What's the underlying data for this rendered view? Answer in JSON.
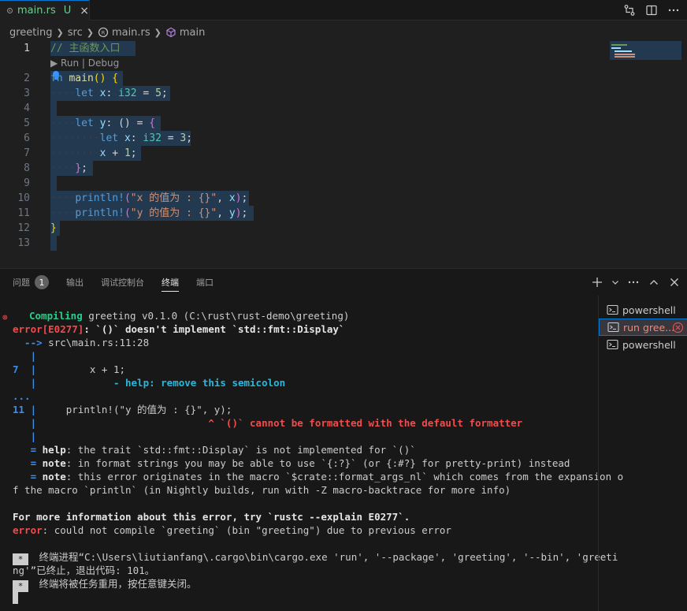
{
  "tabbar": {
    "file_name": "main.rs",
    "file_status": "U",
    "close": "×"
  },
  "breadcrumb": [
    "greeting",
    "src",
    "main.rs",
    "main"
  ],
  "editor": {
    "codelens": "▶ Run | Debug",
    "lines": [
      {
        "n": "1",
        "comment": "// 主函数入口"
      },
      {
        "n": "2"
      },
      {
        "n": "3"
      },
      {
        "n": "4"
      },
      {
        "n": "5"
      },
      {
        "n": "6"
      },
      {
        "n": "7"
      },
      {
        "n": "8"
      },
      {
        "n": "9"
      },
      {
        "n": "10"
      },
      {
        "n": "11"
      },
      {
        "n": "12"
      },
      {
        "n": "13"
      }
    ],
    "code": {
      "fn_kw": "fn",
      "main": "main",
      "let": "let",
      "x": "x",
      "y": "y",
      "i32": "i32",
      "five": "5",
      "three": "3",
      "one": "1",
      "println": "println!",
      "str_x": "\"x 的值为 : {}\"",
      "str_y": "\"y 的值为 : {}\""
    }
  },
  "panel": {
    "tabs": [
      {
        "label": "问题",
        "badge": "1"
      },
      {
        "label": "输出"
      },
      {
        "label": "调试控制台"
      },
      {
        "label": "终端"
      },
      {
        "label": "端口"
      }
    ],
    "terminal_list": [
      "powershell",
      "run gree...",
      "powershell"
    ]
  },
  "terminal": {
    "compiling_label": "Compiling",
    "compiling_rest": " greeting v0.1.0 (C:\\rust\\rust-demo\\greeting)",
    "error_code": "error[E0277]",
    "error_msg": ": `()` doesn't implement `std::fmt::Display`",
    "arrow": "  -->",
    "location": " src\\main.rs:11:28",
    "pipe": "   |",
    "ln7": "7",
    "ln7_pipe": "  |",
    "ln7_code": "         x + 1;",
    "help_line": "             - help: remove this semicolon",
    "dots": "...",
    "ln11": "11",
    "ln11_pipe": " |",
    "ln11_code": "     println!(\"y 的值为 : {}\", y);",
    "caret_line": "                             ^ `()` cannot be formatted with the default formatter",
    "eq": "   = ",
    "help_kw": "help",
    "help_text": ": the trait `std::fmt::Display` is not implemented for `()`",
    "note_kw": "note",
    "note1_text": ": in format strings you may be able to use `{:?}` (or {:#?} for pretty-print) instead",
    "note2_text": ": this error originates in the macro `$crate::format_args_nl` which comes from the expansion o",
    "note2_cont": "f the macro `println` (in Nightly builds, run with -Z macro-backtrace for more info)",
    "more_info": "For more information about this error, try `rustc --explain E0277`.",
    "error_kw": "error",
    "could_not": ": could not compile `greeting` (bin \"greeting\") due to previous error",
    "star": "*",
    "proc_end_1": " 终端进程“C:\\Users\\liutianfang\\.cargo\\bin\\cargo.exe 'run', '--package', 'greeting', '--bin', 'greeti",
    "proc_end_2": "ng'”已终止，退出代码: 101。",
    "reuse": " 终端将被任务重用，按任意键关闭。"
  }
}
